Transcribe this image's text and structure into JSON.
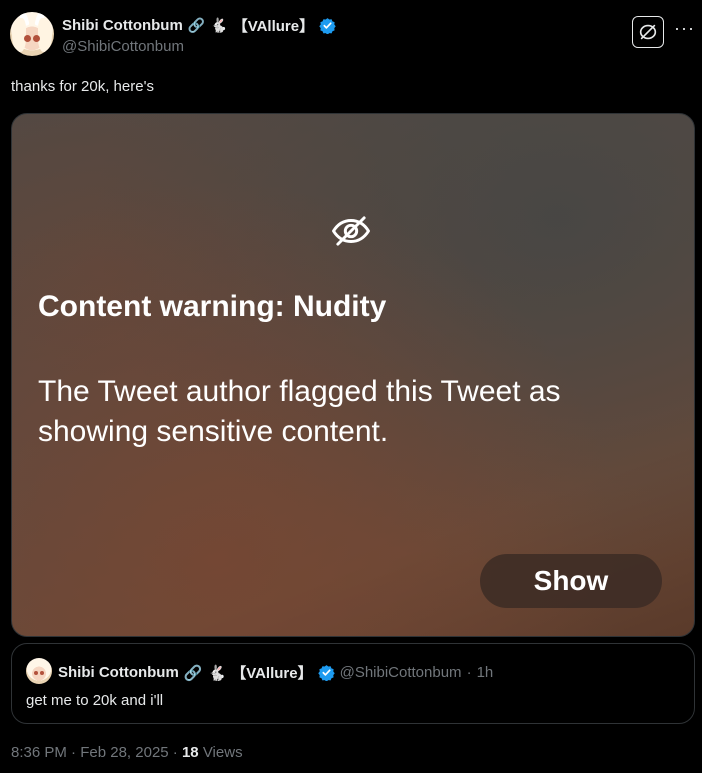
{
  "author": {
    "display_name": "Shibi Cottonbum",
    "emoji_chain": "🔗",
    "emoji_rabbit": "🐇",
    "tag": "【VAllure】",
    "handle": "@ShibiCottonbum"
  },
  "tweet": {
    "text": "thanks for 20k, here's"
  },
  "media": {
    "warning_title": "Content warning: Nudity",
    "warning_body": "The Tweet author flagged this Tweet as showing sensitive content.",
    "show_label": "Show"
  },
  "quoted": {
    "display_name": "Shibi Cottonbum",
    "emoji_chain": "🔗",
    "emoji_rabbit": "🐇",
    "tag": "【VAllure】",
    "handle": "@ShibiCottonbum",
    "separator": "·",
    "age": "1h",
    "text": "get me to 20k and i'll"
  },
  "meta": {
    "time": "8:36 PM",
    "sep1": "·",
    "date": "Feb 28, 2025",
    "sep2": "·",
    "views_count": "18",
    "views_label": "Views"
  },
  "colors": {
    "background": "#000000",
    "text_primary": "#e7e9ea",
    "text_secondary": "#71767b",
    "verified_blue": "#1d9bf0",
    "border": "#2f3336"
  },
  "icons": {
    "verified": "verified-badge-icon",
    "hide_media": "eye-off-icon",
    "more": "more-options-icon"
  }
}
